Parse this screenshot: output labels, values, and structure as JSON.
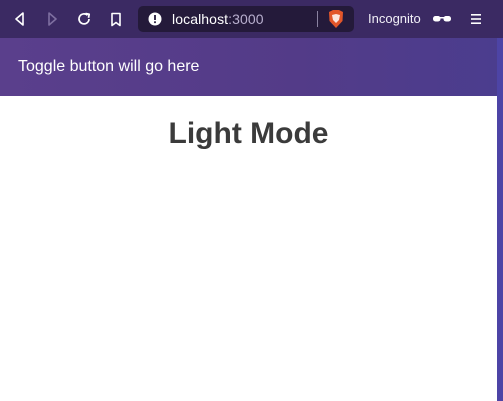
{
  "browser": {
    "url_host": "localhost",
    "url_port": ":3000",
    "incognito_label": "Incognito",
    "icons": [
      "back-icon",
      "forward-icon",
      "reload-icon",
      "bookmark-icon",
      "site-info-icon",
      "brave-shield-icon",
      "incognito-glasses-icon",
      "menu-icon"
    ]
  },
  "header": {
    "text": "Toggle button will go here"
  },
  "main": {
    "title": "Light Mode"
  },
  "colors": {
    "toolbar": "#3b2a63",
    "header": "#533b88",
    "content_bg": "#ffffff",
    "title": "#3b3b3b",
    "brave_orange": "#e2562a"
  }
}
